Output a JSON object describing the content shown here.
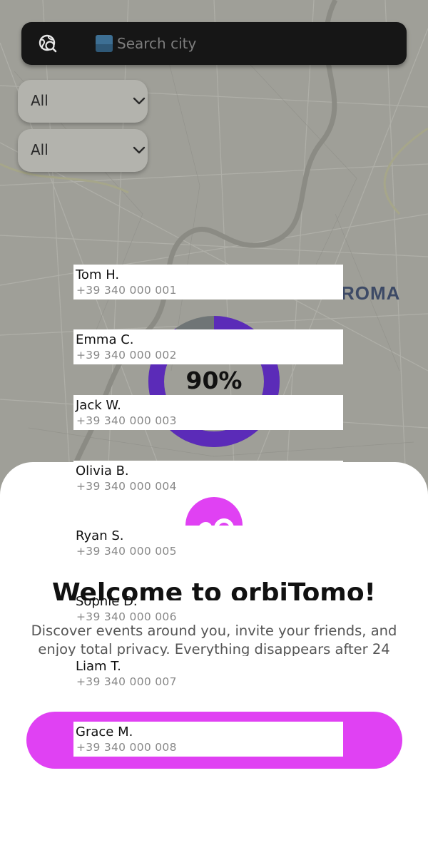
{
  "map": {
    "city_label": "ROMA"
  },
  "search": {
    "placeholder": "Search city",
    "flag_icon": "flag-icon"
  },
  "filters": [
    {
      "value": "All"
    },
    {
      "value": "All"
    }
  ],
  "progress": {
    "label": "90%",
    "value": 0.9,
    "color": "#5b2bb8"
  },
  "sheet": {
    "title": "Welcome to orbiTomo!",
    "description": "Discover events around you, invite your friends, and enjoy total privacy. Everything disappears after 24 hours.",
    "cta_color": "#e041f3",
    "logo_color": "#e041f3"
  },
  "contacts": [
    {
      "name": "Tom H.",
      "phone": "+39 340 000 001"
    },
    {
      "name": "Emma C.",
      "phone": "+39 340 000 002"
    },
    {
      "name": "Jack W.",
      "phone": "+39 340 000 003"
    },
    {
      "name": "Olivia B.",
      "phone": "+39 340 000 004"
    },
    {
      "name": "Ryan S.",
      "phone": "+39 340 000 005"
    },
    {
      "name": "Sophie D.",
      "phone": "+39 340 000 006"
    },
    {
      "name": "Liam T.",
      "phone": "+39 340 000 007"
    },
    {
      "name": "Grace M.",
      "phone": "+39 340 000 008"
    }
  ]
}
